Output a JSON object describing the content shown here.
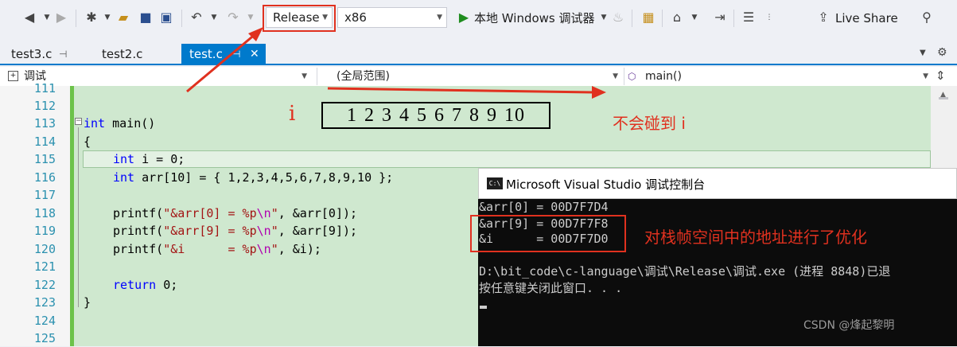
{
  "toolbar": {
    "config": "Release",
    "platform": "x86",
    "debugger": "本地 Windows 调试器",
    "live_share": "Live Share"
  },
  "tabs": [
    {
      "label": "test3.c",
      "pin": "⊣"
    },
    {
      "label": "test2.c"
    },
    {
      "label": "test.c",
      "pin": "⊣",
      "close": "✕"
    }
  ],
  "navbar": {
    "project": "调试",
    "scope": "(全局范围)",
    "member": "main()"
  },
  "lines": [
    "111",
    "112",
    "113",
    "114",
    "115",
    "116",
    "117",
    "118",
    "119",
    "120",
    "121",
    "122",
    "123",
    "124",
    "125"
  ],
  "code": {
    "l113_kw": "int",
    "l113_rest": " main()",
    "l114": "{",
    "l115_kw": "int",
    "l115_rest": " i = 0;",
    "l116_kw": "int",
    "l116_rest": " arr[10] = { 1,2,3,4,5,6,7,8,9,10 };",
    "l118_a": "printf(",
    "l118_s1": "\"&arr[0] = %p",
    "l118_esc": "\\n",
    "l118_s2": "\"",
    "l118_b": ", &arr[0]);",
    "l119_a": "printf(",
    "l119_s1": "\"&arr[9] = %p",
    "l119_esc": "\\n",
    "l119_s2": "\"",
    "l119_b": ", &arr[9]);",
    "l120_a": "printf(",
    "l120_s1": "\"&i      = %p",
    "l120_esc": "\\n",
    "l120_s2": "\"",
    "l120_b": ", &i);",
    "l122_kw": "return",
    "l122_rest": " 0;",
    "l123": "}"
  },
  "annotations": {
    "i_label": "i",
    "array_values": "1 2 3 4 5 6 7 8 9 10",
    "no_collide": "不会碰到 i",
    "console_note": "对栈帧空间中的地址进行了优化"
  },
  "console": {
    "title": "Microsoft Visual Studio 调试控制台",
    "icon_text": "C:\\",
    "lines": [
      "&arr[0] = 00D7F7D4",
      "&arr[9] = 00D7F7F8",
      "&i      = 00D7F7D0",
      "",
      "D:\\bit_code\\c-language\\调试\\Release\\调试.exe (进程 8848)已退",
      "按任意键关闭此窗口. . ."
    ]
  },
  "watermark": "CSDN @烽起黎明",
  "colors": {
    "accent": "#007acc",
    "annotation_red": "#e0311f",
    "code_bg": "#cfe8cf"
  }
}
